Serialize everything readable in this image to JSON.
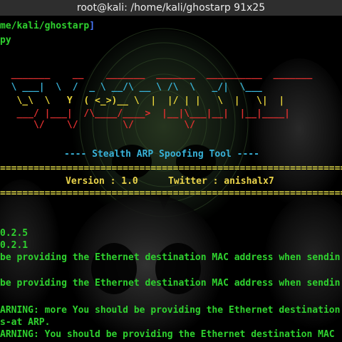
{
  "window": {
    "title": "root@kali: /home/kali/ghostarp 91x25"
  },
  "terminal": {
    "prompt_path": "me/kali/ghostarp",
    "prompt_close": "]",
    "command": "py",
    "banner": {
      "art_lines": [
        "  _______    __    _______  _______  __________  _______",
        "  \\ ___|  \\  /  _ \\ __/\\ __ \\ /\\  \\   _/|  \\___",
        "   \\_\\  \\   Y  ( <_>)__ \\  |  |/ | |   \\  |   \\|  |",
        "   ___/ |___|  /\\____/____>  |__|\\___|__|  |__|____|",
        "      \\/    \\/        \\/         \\/                  "
      ],
      "subtitle": "---- Stealth ARP Spoofing Tool ----",
      "separator": "================================================================",
      "version_label": "Version : 1.0",
      "twitter_label": "Twitter : anishalx7"
    },
    "output": [
      "0.2.5",
      "0.2.1",
      "be providing the Ethernet destination MAC address when sendin",
      "be providing the Ethernet destination MAC address when sendin",
      "ARNING: more You should be providing the Ethernet destination",
      "s-at ARP.",
      "ARNING: You should be providing the Ethernet destination MAC"
    ]
  },
  "colors": {
    "prompt_green": "#2fd22f",
    "banner_red": "#e0302f",
    "banner_yellow": "#e6d23a",
    "banner_cyan": "#38b2d8",
    "titlebar_bg": "#2e2e2e"
  }
}
